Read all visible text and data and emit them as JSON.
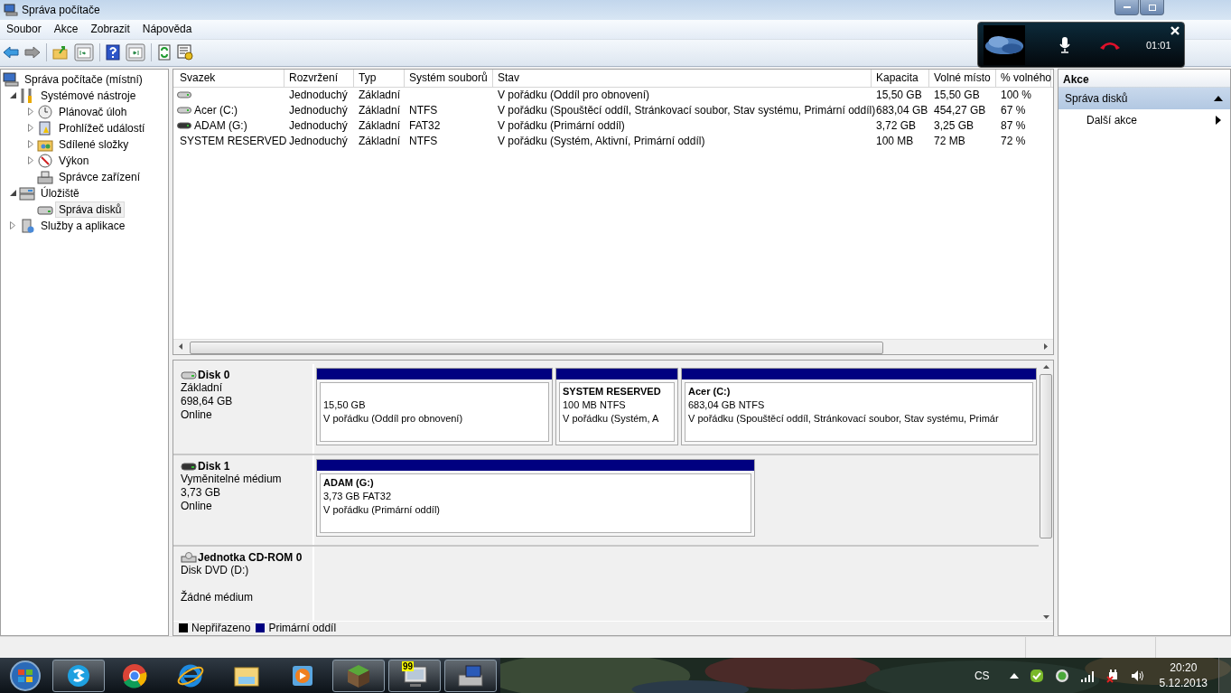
{
  "window": {
    "title": "Správa počítače"
  },
  "menu": [
    "Soubor",
    "Akce",
    "Zobrazit",
    "Nápověda"
  ],
  "tree": [
    {
      "label": "Správa počítače (místní)",
      "expandable": false,
      "selected": false,
      "children": [
        {
          "label": "Systémové nástroje",
          "expandable": true,
          "expanded": true,
          "selected": false,
          "children": [
            {
              "label": "Plánovač úloh",
              "expandable": true,
              "expanded": false,
              "selected": false
            },
            {
              "label": "Prohlížeč událostí",
              "expandable": true,
              "expanded": false,
              "selected": false
            },
            {
              "label": "Sdílené složky",
              "expandable": true,
              "expanded": false,
              "selected": false
            },
            {
              "label": "Výkon",
              "expandable": true,
              "expanded": false,
              "selected": false
            },
            {
              "label": "Správce zařízení",
              "expandable": false,
              "selected": false
            }
          ]
        },
        {
          "label": "Úložiště",
          "expandable": true,
          "expanded": true,
          "selected": false,
          "children": [
            {
              "label": "Správa disků",
              "expandable": false,
              "selected": true
            }
          ]
        },
        {
          "label": "Služby a aplikace",
          "expandable": true,
          "expanded": false,
          "selected": false
        }
      ]
    }
  ],
  "volumes": {
    "columns": [
      "Svazek",
      "Rozvržení",
      "Typ",
      "Systém souborů",
      "Stav",
      "Kapacita",
      "Volné místo",
      "% volného"
    ],
    "rows": [
      {
        "kind": "fixed",
        "cells": [
          "",
          "Jednoduchý",
          "Základní",
          "",
          "V pořádku (Oddíl pro obnovení)",
          "15,50 GB",
          "15,50 GB",
          "100 %"
        ]
      },
      {
        "kind": "fixed",
        "cells": [
          "Acer (C:)",
          "Jednoduchý",
          "Základní",
          "NTFS",
          "V pořádku (Spouštěcí oddíl, Stránkovací soubor, Stav systému, Primární oddíl)",
          "683,04 GB",
          "454,27 GB",
          "67 %"
        ]
      },
      {
        "kind": "removable",
        "cells": [
          "ADAM (G:)",
          "Jednoduchý",
          "Základní",
          "FAT32",
          "V pořádku (Primární oddíl)",
          "3,72 GB",
          "3,25 GB",
          "87 %"
        ]
      },
      {
        "kind": "fixed",
        "cells": [
          "SYSTEM RESERVED",
          "Jednoduchý",
          "Základní",
          "NTFS",
          "V pořádku (Systém, Aktivní, Primární oddíl)",
          "100 MB",
          "72 MB",
          "72 %"
        ]
      }
    ]
  },
  "disks": [
    {
      "kind": "fixed",
      "name": "Disk 0",
      "lines": [
        "Základní",
        "698,64 GB",
        "Online"
      ],
      "partitions": [
        {
          "size": "15,50 GB",
          "status": "V pořádku (Oddíl pro obnovení)",
          "color": "#000080"
        },
        {
          "name": "SYSTEM RESERVED",
          "size": "100 MB NTFS",
          "status": "V pořádku (Systém, A",
          "color": "#000080"
        },
        {
          "name": "Acer  (C:)",
          "size": "683,04 GB NTFS",
          "status": "V pořádku (Spouštěcí oddíl, Stránkovací soubor, Stav systému, Primár",
          "color": "#000080"
        }
      ]
    },
    {
      "kind": "removable",
      "name": "Disk 1",
      "lines": [
        "Vyměnitelné médium",
        "3,73 GB",
        "Online"
      ],
      "partitions": [
        {
          "name": "ADAM  (G:)",
          "size": "3,73 GB FAT32",
          "status": "V pořádku (Primární oddíl)",
          "color": "#000080"
        }
      ]
    },
    {
      "kind": "cdrom",
      "name": "Jednotka CD-ROM 0",
      "lines": [
        "Disk DVD (D:)",
        "Žádné médium"
      ]
    }
  ],
  "legend": [
    {
      "label": "Nepřiřazeno",
      "color": "#000000"
    },
    {
      "label": "Primární oddíl",
      "color": "#000080"
    }
  ],
  "actions": {
    "title": "Akce",
    "section": {
      "label": "Správa disků",
      "expanded": true
    },
    "items": [
      "Další akce"
    ]
  },
  "call": {
    "time": "01:01"
  },
  "taskbar": {
    "apps": [
      {
        "running": true
      },
      {
        "running": false
      },
      {
        "running": false
      },
      {
        "running": false
      },
      {
        "running": false
      },
      {
        "running": true
      },
      {
        "running": true,
        "badge": "99"
      },
      {
        "running": true
      }
    ],
    "language": "CS",
    "time": "20:20",
    "date": "5.12.2013"
  }
}
